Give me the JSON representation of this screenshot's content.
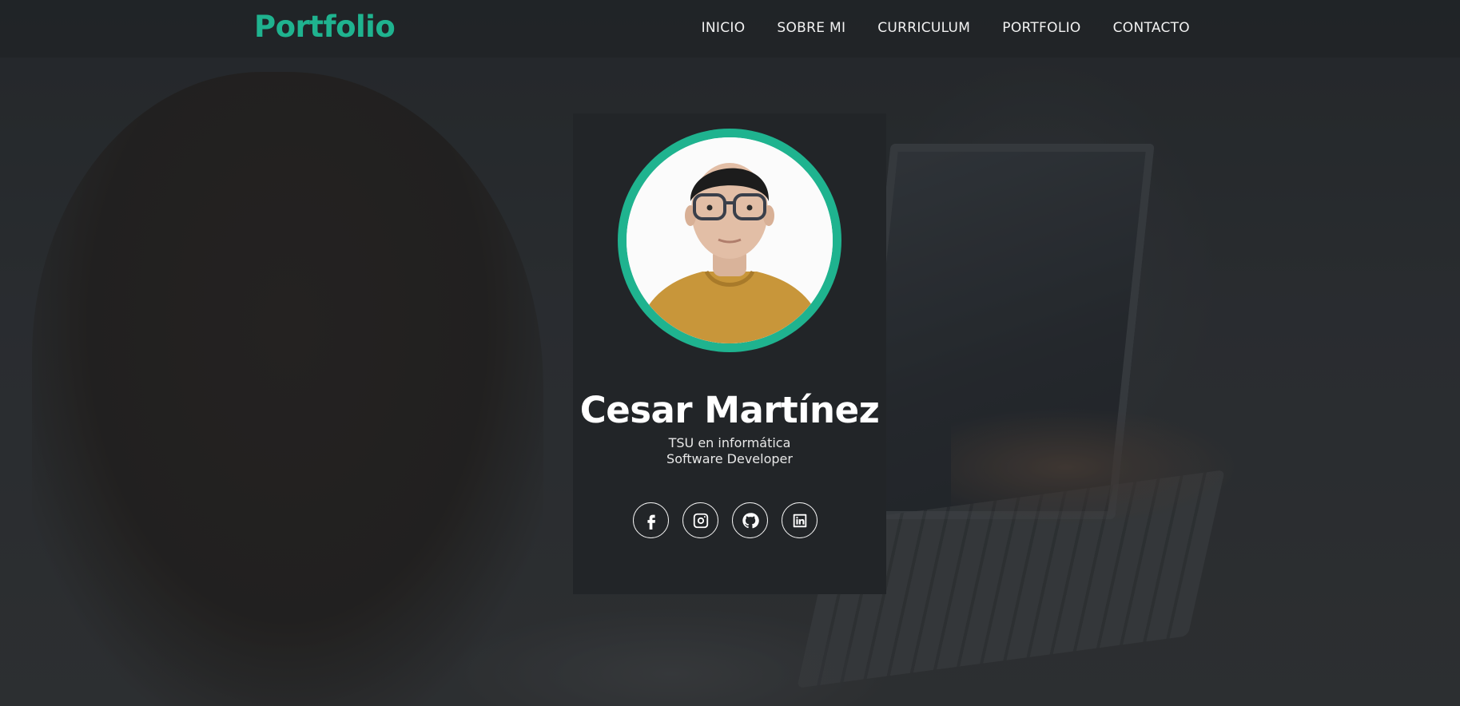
{
  "header": {
    "logo": "Portfolio",
    "nav": [
      {
        "label": "INICIO"
      },
      {
        "label": "SOBRE MI"
      },
      {
        "label": "CURRICULUM"
      },
      {
        "label": "PORTFOLIO"
      },
      {
        "label": "CONTACTO"
      }
    ]
  },
  "profile": {
    "name": "Cesar Martínez",
    "subtitle_1": "TSU en informática",
    "subtitle_2": "Software Developer",
    "socials": [
      {
        "icon": "facebook-icon"
      },
      {
        "icon": "instagram-icon"
      },
      {
        "icon": "github-icon"
      },
      {
        "icon": "linkedin-icon"
      }
    ]
  },
  "colors": {
    "accent": "#1fb38f",
    "card": "#222528",
    "header": "#212427"
  }
}
